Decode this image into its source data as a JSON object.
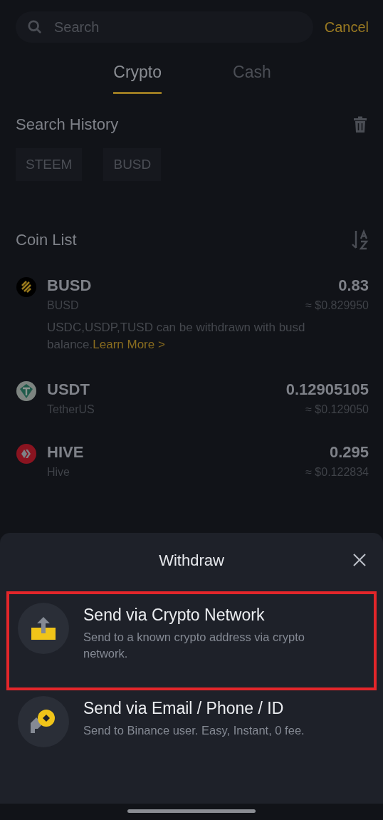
{
  "search": {
    "placeholder": "Search",
    "cancel": "Cancel"
  },
  "tabs": [
    {
      "label": "Crypto",
      "selected": true
    },
    {
      "label": "Cash",
      "selected": false
    }
  ],
  "search_history": {
    "title": "Search History",
    "chips": [
      "STEEM",
      "BUSD"
    ]
  },
  "coin_list": {
    "title": "Coin List",
    "coins": [
      {
        "kind": "busd",
        "symbol": "BUSD",
        "name": "BUSD",
        "amount": "0.83",
        "value": "≈ $0.829950",
        "note": "USDC,USDP,TUSD can be withdrawn with busd balance.",
        "link": "Learn More >"
      },
      {
        "kind": "usdt",
        "symbol": "USDT",
        "name": "TetherUS",
        "amount": "0.12905105",
        "value": "≈ $0.129050"
      },
      {
        "kind": "hive",
        "symbol": "HIVE",
        "name": "Hive",
        "amount": "0.295",
        "value": "≈ $0.122834"
      }
    ]
  },
  "sheet": {
    "title": "Withdraw",
    "options": [
      {
        "kind": "crypto",
        "title": "Send via Crypto Network",
        "description": "Send to a known crypto address via crypto network.",
        "highlighted": true
      },
      {
        "kind": "internal",
        "title": "Send via Email / Phone / ID",
        "description": "Send to Binance user. Easy, Instant, 0 fee.",
        "highlighted": false
      }
    ]
  }
}
